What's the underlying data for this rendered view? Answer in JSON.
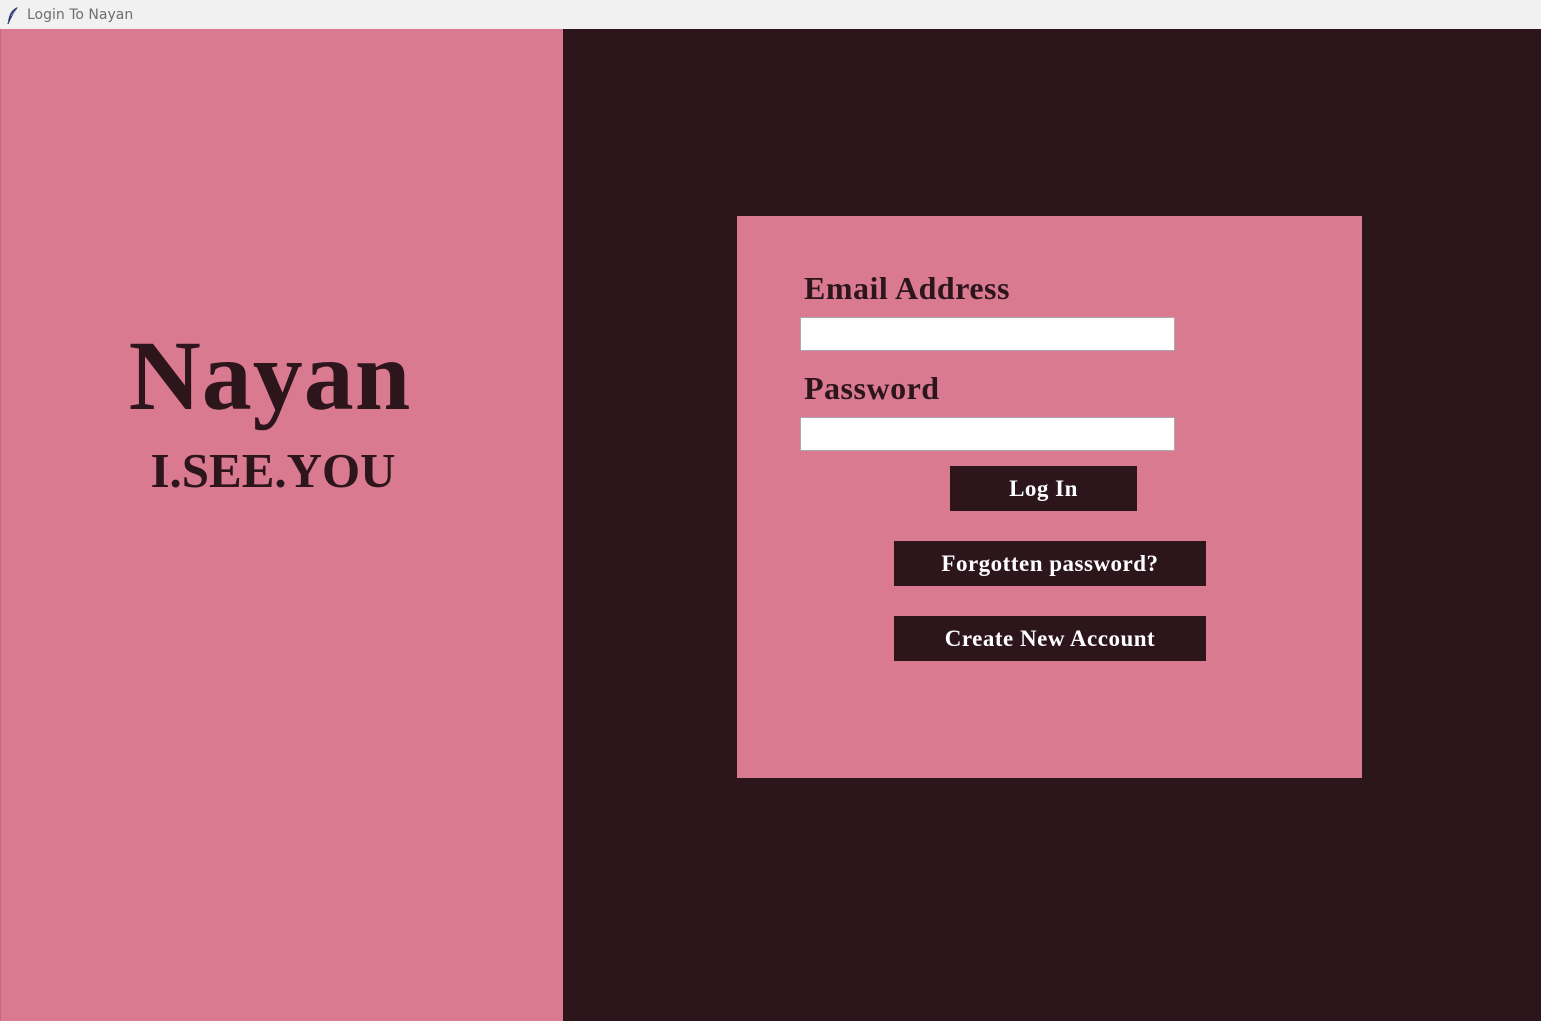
{
  "window": {
    "title": "Login To Nayan",
    "icon": "feather-icon"
  },
  "brand": {
    "name": "Nayan",
    "tagline": "I.SEE.YOU"
  },
  "login_form": {
    "email_label": "Email Address",
    "email_value": "",
    "password_label": "Password",
    "password_value": "",
    "login_button": "Log In",
    "forgot_button": "Forgotten password?",
    "create_button": "Create New Account"
  },
  "colors": {
    "accent_pink": "#da7a91",
    "dark_maroon": "#2d151c",
    "titlebar_bg": "#f1f1f1"
  }
}
